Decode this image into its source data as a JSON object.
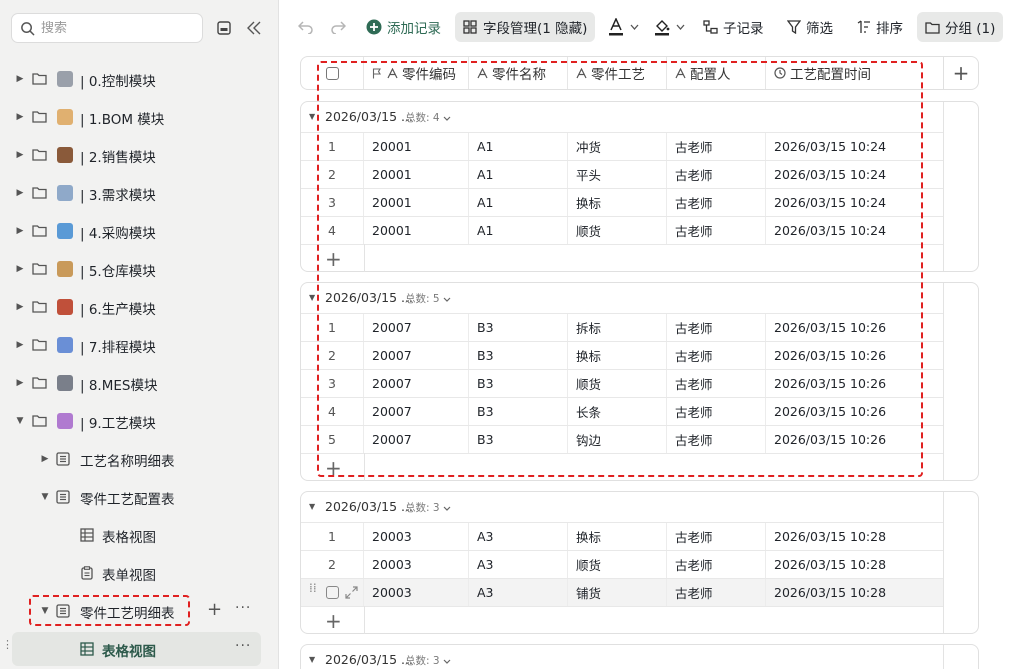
{
  "sidebar": {
    "search_placeholder": "搜索",
    "items": [
      {
        "label": "| 0.控制模块",
        "emoji_color": "#9aa0aa"
      },
      {
        "label": "| 1.BOM 模块",
        "emoji_color": "#e0b070"
      },
      {
        "label": "| 2.销售模块",
        "emoji_color": "#8a5a3a"
      },
      {
        "label": "| 3.需求模块",
        "emoji_color": "#8fa9c9"
      },
      {
        "label": "| 4.采购模块",
        "emoji_color": "#5a9ad6"
      },
      {
        "label": "| 5.仓库模块",
        "emoji_color": "#c99a5a"
      },
      {
        "label": "| 6.生产模块",
        "emoji_color": "#c0503a"
      },
      {
        "label": "| 7.排程模块",
        "emoji_color": "#6a8fd6"
      },
      {
        "label": "| 8.MES模块",
        "emoji_color": "#7a7f8a"
      },
      {
        "label": "| 9.工艺模块",
        "emoji_color": "#b07ad0"
      }
    ],
    "sub_items": [
      {
        "label": "工艺名称明细表"
      },
      {
        "label": "零件工艺配置表"
      },
      {
        "label": "表格视图"
      },
      {
        "label": "表单视图"
      },
      {
        "label": "零件工艺明细表"
      },
      {
        "label": "表格视图"
      }
    ]
  },
  "toolbar": {
    "add_record": "添加记录",
    "field_manage": "字段管理(1 隐藏)",
    "sub_record": "子记录",
    "filter": "筛选",
    "sort": "排序",
    "group": "分组 (1)"
  },
  "table": {
    "columns": [
      "零件编码",
      "零件名称",
      "零件工艺",
      "配置人",
      "工艺配置时间"
    ],
    "count_label": "总数:",
    "groups": [
      {
        "title": "2026/03/15 ...",
        "count": "4",
        "rows": [
          [
            "1",
            "20001",
            "A1",
            "冲货",
            "古老师",
            "2026/03/15 10:24"
          ],
          [
            "2",
            "20001",
            "A1",
            "平头",
            "古老师",
            "2026/03/15 10:24"
          ],
          [
            "3",
            "20001",
            "A1",
            "换标",
            "古老师",
            "2026/03/15 10:24"
          ],
          [
            "4",
            "20001",
            "A1",
            "顺货",
            "古老师",
            "2026/03/15 10:24"
          ]
        ]
      },
      {
        "title": "2026/03/15 ...",
        "count": "5",
        "rows": [
          [
            "1",
            "20007",
            "B3",
            "拆标",
            "古老师",
            "2026/03/15 10:26"
          ],
          [
            "2",
            "20007",
            "B3",
            "换标",
            "古老师",
            "2026/03/15 10:26"
          ],
          [
            "3",
            "20007",
            "B3",
            "顺货",
            "古老师",
            "2026/03/15 10:26"
          ],
          [
            "4",
            "20007",
            "B3",
            "长条",
            "古老师",
            "2026/03/15 10:26"
          ],
          [
            "5",
            "20007",
            "B3",
            "钩边",
            "古老师",
            "2026/03/15 10:26"
          ]
        ]
      },
      {
        "title": "2026/03/15 ...",
        "count": "3",
        "rows": [
          [
            "1",
            "20003",
            "A3",
            "换标",
            "古老师",
            "2026/03/15 10:28"
          ],
          [
            "2",
            "20003",
            "A3",
            "顺货",
            "古老师",
            "2026/03/15 10:28"
          ],
          [
            "",
            "20003",
            "A3",
            "铺货",
            "古老师",
            "2026/03/15 10:28"
          ]
        ]
      },
      {
        "title": "2026/03/15 ...",
        "count": "3",
        "rows": []
      }
    ]
  }
}
